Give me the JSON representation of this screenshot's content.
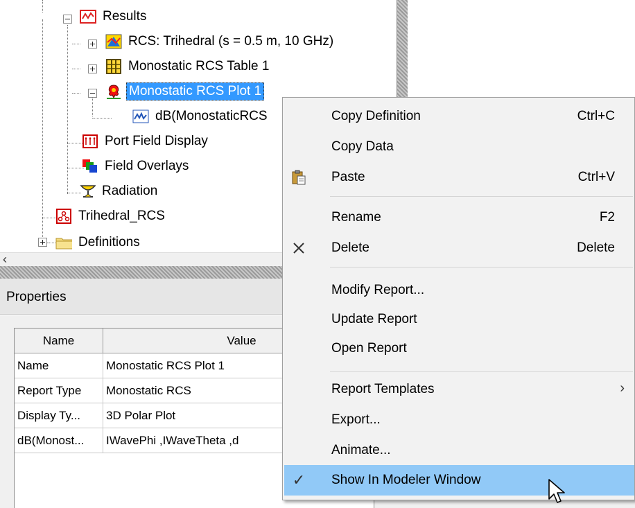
{
  "tree": {
    "items": [
      {
        "label": "Results"
      },
      {
        "label": "RCS: Trihedral (s = 0.5 m, 10 GHz)"
      },
      {
        "label": "Monostatic RCS Table 1"
      },
      {
        "label": "Monostatic RCS Plot 1"
      },
      {
        "label": "dB(MonostaticRCS"
      },
      {
        "label": "Port Field Display"
      },
      {
        "label": "Field Overlays"
      },
      {
        "label": "Radiation"
      },
      {
        "label": "Trihedral_RCS"
      },
      {
        "label": "Definitions"
      }
    ],
    "scroll_arrow": "‹"
  },
  "properties": {
    "title": "Properties",
    "headers": {
      "name": "Name",
      "value": "Value"
    },
    "rows": [
      {
        "name": "Name",
        "value": "Monostatic RCS Plot 1"
      },
      {
        "name": "Report Type",
        "value": "Monostatic RCS"
      },
      {
        "name": "Display Ty...",
        "value": "3D Polar Plot"
      },
      {
        "name": "dB(Monost...",
        "value": "IWavePhi ,IWaveTheta ,d"
      }
    ]
  },
  "menu": {
    "items": [
      {
        "label": "Copy Definition",
        "shortcut": "Ctrl+C"
      },
      {
        "label": "Copy Data",
        "shortcut": ""
      },
      {
        "label": "Paste",
        "shortcut": "Ctrl+V",
        "icon": "paste-icon"
      },
      {
        "label": "Rename",
        "shortcut": "F2"
      },
      {
        "label": "Delete",
        "shortcut": "Delete",
        "icon": "delete-x-icon"
      },
      {
        "label": "Modify Report...",
        "shortcut": ""
      },
      {
        "label": "Update Report",
        "shortcut": ""
      },
      {
        "label": "Open Report",
        "shortcut": ""
      },
      {
        "label": "Report Templates",
        "shortcut": "",
        "submenu": "›"
      },
      {
        "label": "Export...",
        "shortcut": ""
      },
      {
        "label": "Animate...",
        "shortcut": ""
      },
      {
        "label": "Show In Modeler Window",
        "shortcut": "",
        "checked": "✓"
      }
    ],
    "highlight_color": "#91c9f7"
  },
  "colors": {
    "selection": "#3399ff",
    "menu_bg": "#f2f2f2"
  }
}
